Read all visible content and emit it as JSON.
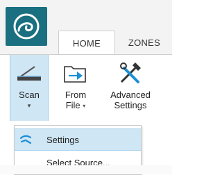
{
  "tabs": [
    {
      "label": "HOME",
      "active": true
    },
    {
      "label": "ZONES",
      "active": false
    }
  ],
  "ribbon": {
    "scan": {
      "label": "Scan"
    },
    "from_file": {
      "line1": "From",
      "line2": "File"
    },
    "advanced": {
      "line1": "Advanced",
      "line2": "Settings"
    }
  },
  "scan_menu": {
    "items": [
      {
        "label": "Settings",
        "icon": "settings-icon"
      },
      {
        "label": "Select Source...",
        "icon": ""
      }
    ]
  },
  "colors": {
    "accent": "#1a6f80",
    "highlight": "#cfe6f5",
    "icon_blue": "#1c8fd6"
  }
}
